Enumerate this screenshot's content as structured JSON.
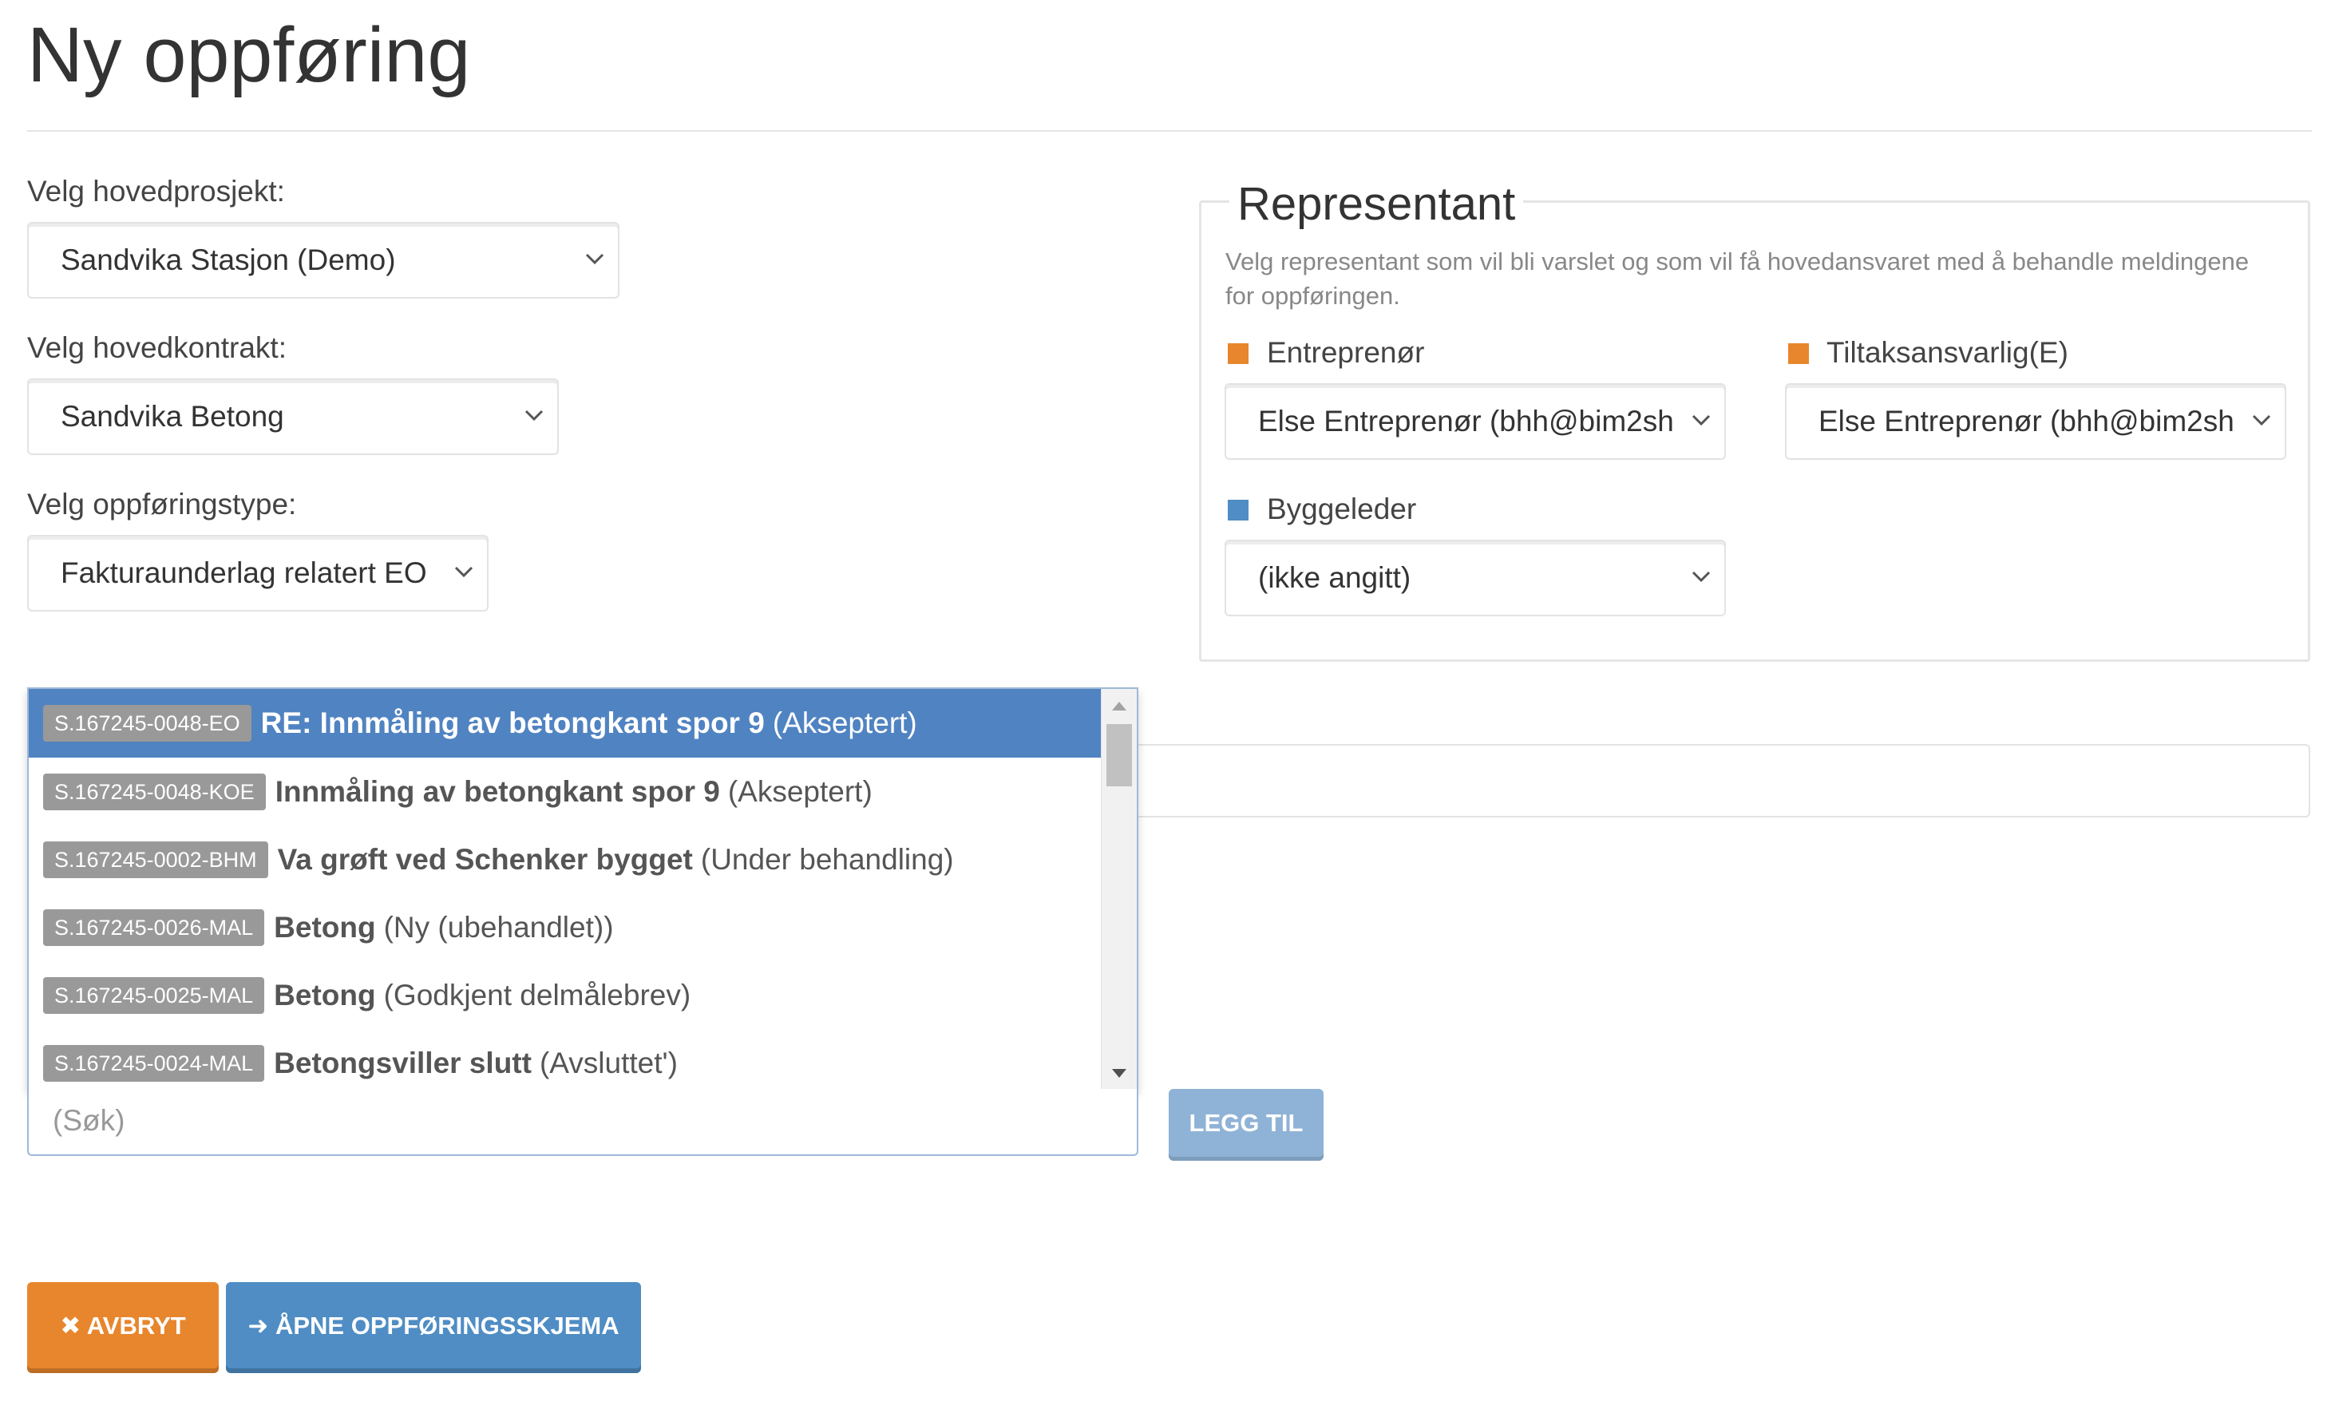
{
  "page": {
    "title": "Ny oppføring"
  },
  "main_project": {
    "label": "Velg hovedprosjekt:",
    "value": "Sandvika Stasjon (Demo)"
  },
  "main_contract": {
    "label": "Velg hovedkontrakt:",
    "value": "Sandvika Betong"
  },
  "entry_type": {
    "label": "Velg oppføringstype:",
    "value": "Fakturaunderlag relatert EO"
  },
  "representative": {
    "legend": "Representant",
    "description": "Velg representant som vil bli varslet og som vil få hovedansvaret med å behandle meldingene for oppføringen.",
    "contractor": {
      "label": "Entreprenør",
      "value": "Else Entreprenør (bhh@bim2sh",
      "color": "#e8862d"
    },
    "responsible": {
      "label": "Tiltaksansvarlig(E)",
      "value": "Else Entreprenør (bhh@bim2sh",
      "color": "#e8862d"
    },
    "site_manager": {
      "label": "Byggeleder",
      "value": "(ikke angitt)",
      "color": "#4f8dc4"
    }
  },
  "dropdown": {
    "items": [
      {
        "code": "S.167245-0048-EO",
        "title": "RE: Innmåling av betongkant spor 9",
        "status": "(Akseptert)",
        "active": true
      },
      {
        "code": "S.167245-0048-KOE",
        "title": "Innmåling av betongkant spor 9",
        "status": "(Akseptert)"
      },
      {
        "code": "S.167245-0002-BHM",
        "title": "Va grøft ved Schenker bygget",
        "status": "(Under behandling)"
      },
      {
        "code": "S.167245-0026-MAL",
        "title": "Betong",
        "status": "(Ny (ubehandlet))"
      },
      {
        "code": "S.167245-0025-MAL",
        "title": "Betong",
        "status": "(Godkjent delmålebrev)"
      },
      {
        "code": "S.167245-0024-MAL",
        "title": "Betongsviller slutt",
        "status": "(Avsluttet')"
      }
    ]
  },
  "search": {
    "placeholder": "(Søk)"
  },
  "add_button": {
    "label": "LEGG TIL"
  },
  "buttons": {
    "cancel": {
      "label": "AVBRYT",
      "icon": "close-icon",
      "color": "#e8862d"
    },
    "open": {
      "label": "ÅPNE OPPFØRINGSSKJEMA",
      "icon": "arrow-right-icon",
      "color": "#4f8dc4"
    }
  }
}
